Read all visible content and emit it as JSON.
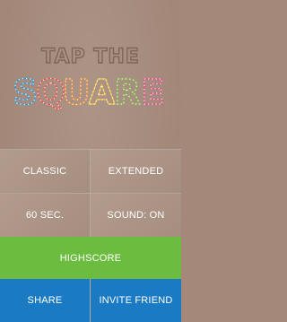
{
  "logo": {
    "line1": "TAP THE",
    "letters": [
      {
        "char": "S",
        "color": "#2d9be0"
      },
      {
        "char": "Q",
        "color": "#f05050"
      },
      {
        "char": "U",
        "color": "#f28d2e"
      },
      {
        "char": "A",
        "color": "#f4c53a"
      },
      {
        "char": "R",
        "color": "#7cc241"
      },
      {
        "char": "E",
        "color": "#ea4c8e"
      }
    ]
  },
  "menu": {
    "classic": "CLASSIC",
    "extended": "EXTENDED",
    "time": "60 SEC.",
    "sound": "SOUND: ON",
    "highscore": "HIGHSCORE",
    "share": "SHARE",
    "invite": "INVITE FRIEND"
  },
  "colors": {
    "background": "#a4897a",
    "highscore": "#6cbd3f",
    "share": "#1a7ac4"
  }
}
